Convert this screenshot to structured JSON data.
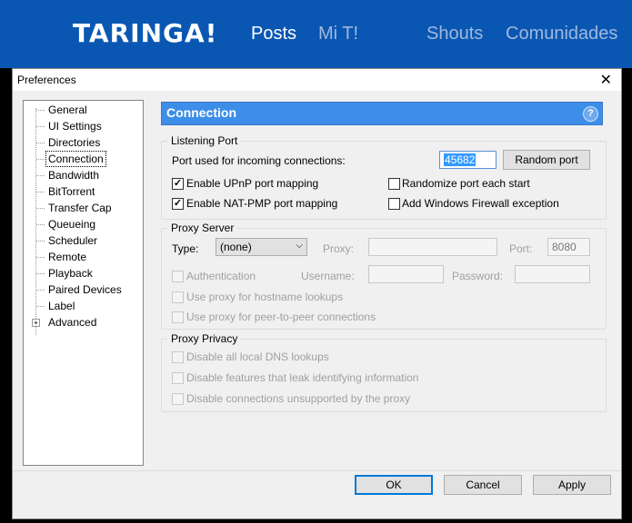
{
  "site": {
    "logo": "TARINGA!",
    "nav": [
      "Posts",
      "Mi T!",
      "Shouts",
      "Comunidades"
    ]
  },
  "dialog": {
    "title": "Preferences",
    "close_glyph": "✕"
  },
  "tree": {
    "items": [
      "General",
      "UI Settings",
      "Directories",
      "Connection",
      "Bandwidth",
      "BitTorrent",
      "Transfer Cap",
      "Queueing",
      "Scheduler",
      "Remote",
      "Playback",
      "Paired Devices",
      "Label",
      "Advanced"
    ],
    "selected": "Connection",
    "expander_glyph": "+"
  },
  "panel": {
    "title": "Connection",
    "help_glyph": "?"
  },
  "listening": {
    "group_title": "Listening Port",
    "port_label": "Port used for incoming connections:",
    "port_value": "45682",
    "random_button": "Random port",
    "upnp": "Enable UPnP port mapping",
    "upnp_checked": true,
    "natpmp": "Enable NAT-PMP port mapping",
    "natpmp_checked": true,
    "randomize": "Randomize port each start",
    "randomize_checked": false,
    "firewall": "Add Windows Firewall exception",
    "firewall_checked": false,
    "check_glyph": "✓"
  },
  "proxy": {
    "group_title": "Proxy Server",
    "type_label": "Type:",
    "type_value": "(none)",
    "proxy_label": "Proxy:",
    "port_label": "Port:",
    "port_value": "8080",
    "auth": "Authentication",
    "username_label": "Username:",
    "password_label": "Password:",
    "hostname": "Use proxy for hostname lookups",
    "p2p": "Use proxy for peer-to-peer connections"
  },
  "privacy": {
    "group_title": "Proxy Privacy",
    "dns": "Disable all local DNS lookups",
    "leak": "Disable features that leak identifying information",
    "unsupported": "Disable connections unsupported by the proxy"
  },
  "footer": {
    "ok": "OK",
    "cancel": "Cancel",
    "apply": "Apply"
  }
}
